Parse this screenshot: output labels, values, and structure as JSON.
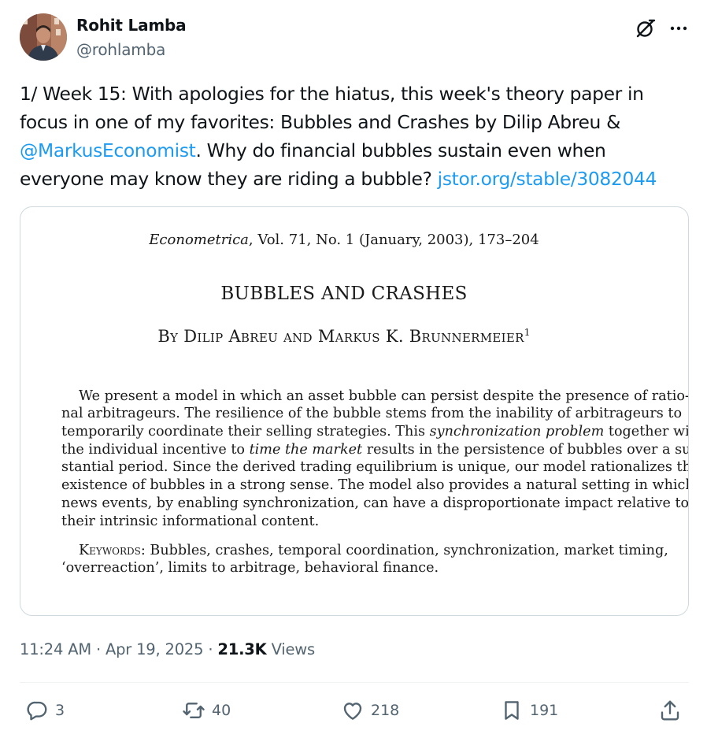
{
  "author": {
    "name": "Rohit Lamba",
    "handle": "@rohlamba"
  },
  "tweet": {
    "text_before": "1/ Week 15: With apologies for the hiatus, this week's theory paper in focus in one of my favorites: Bubbles and Crashes by Dilip Abreu & ",
    "mention": "@MarkusEconomist",
    "text_middle": ". Why do financial bubbles sustain even when everyone may know they are riding a bubble? ",
    "link": "jstor.org/stable/3082044"
  },
  "paper": {
    "journal_name": "Econometrica",
    "journal_rest": ", Vol. 71, No. 1 (January, 2003), 173–204",
    "title": "BUBBLES AND CRASHES",
    "authors": "By Dilip Abreu and Markus K. Brunnermeier",
    "footnote": "1",
    "abstract": {
      "l1": "We present a model in which an asset bubble can persist despite the presence of ratio-",
      "l2": "nal arbitrageurs. The resilience of the bubble stems from the inability of arbitrageurs to",
      "l3a": "temporarily coordinate their selling strategies. This ",
      "l3b": "synchronization problem",
      "l3c": " together with",
      "l4a": "the individual incentive to ",
      "l4b": "time the market",
      "l4c": " results in the persistence of bubbles over a sub-",
      "l5": "stantial period. Since the derived trading equilibrium is unique, our model rationalizes the",
      "l6": "existence of bubbles in a strong sense. The model also provides a natural setting in which",
      "l7": "news events, by enabling synchronization, can have a disproportionate impact relative to",
      "l8": "their intrinsic informational content."
    },
    "keywords_label": "Keywords:",
    "keywords_l1": " Bubbles, crashes, temporal coordination, synchronization, market timing,",
    "keywords_l2": "‘overreaction’, limits to arbitrage, behavioral finance."
  },
  "meta": {
    "time": "11:24 AM",
    "sep": "·",
    "date": "Apr 19, 2025",
    "views_count": "21.3K",
    "views_label": "Views"
  },
  "actions": {
    "replies": "3",
    "reposts": "40",
    "likes": "218",
    "bookmarks": "191"
  },
  "colors": {
    "link": "#1d9bf0",
    "secondary_text": "#536471",
    "primary_text": "#0f1419",
    "border": "#cfd9de"
  },
  "icons": [
    "grok-icon",
    "more-icon",
    "reply-icon",
    "repost-icon",
    "like-icon",
    "bookmark-icon",
    "share-icon"
  ]
}
